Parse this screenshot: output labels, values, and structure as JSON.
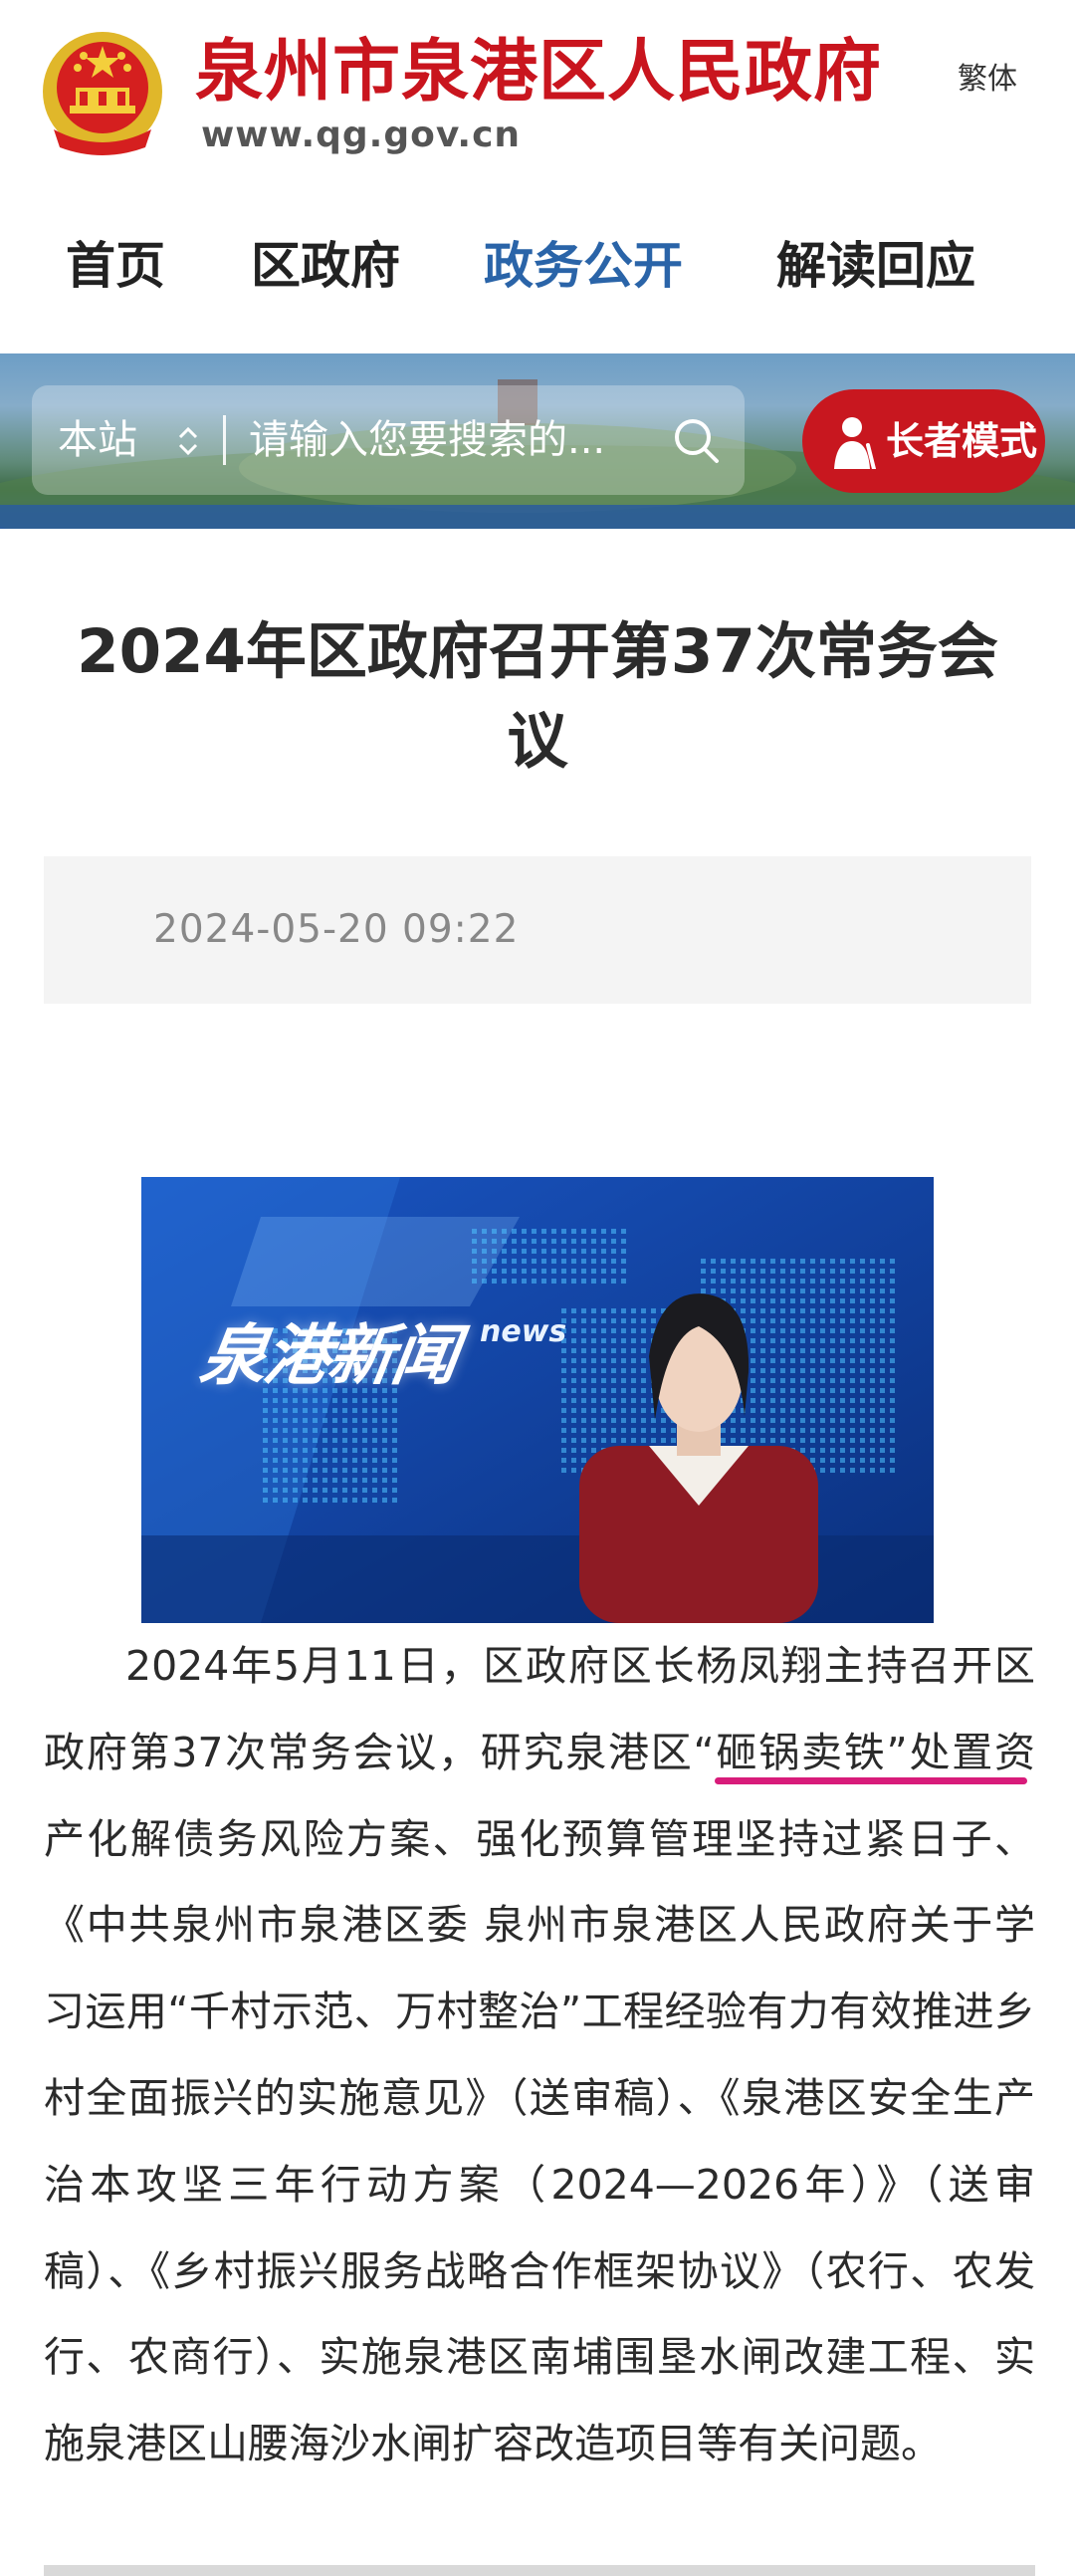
{
  "header": {
    "site_name": "泉州市泉港区人民政府",
    "site_url": "www.qg.gov.cn",
    "traditional_label": "繁体",
    "emblem_icon": "national-emblem-icon"
  },
  "nav": {
    "items": [
      {
        "label": "首页",
        "active": false
      },
      {
        "label": "区政府",
        "active": false
      },
      {
        "label": "政务公开",
        "active": true
      },
      {
        "label": "解读回应",
        "active": false
      }
    ]
  },
  "search": {
    "scope_label": "本站",
    "placeholder": "请输入您要搜索的...",
    "icon": "search-icon"
  },
  "elder_mode": {
    "label": "长者模式",
    "icon": "elder-person-icon"
  },
  "article": {
    "title": "2024年区政府召开第37次常务会议",
    "date": "2024-05-20 09:22",
    "video_logo_text": "泉港新闻",
    "video_logo_en": "news",
    "body": "2024年5月11日，区政府区长杨凤翔主持召开区政府第37次常务会议，研究泉港区“砸锅卖铁”处置资产化解债务风险方案、强化预算管理坚持过紧日子、《中共泉州市泉港区委 泉州市泉港区人民政府关于学习运用“千村示范、万村整治”工程经验有力有效推进乡村全面振兴的实施意见》（送审稿）、《泉港区安全生产治本攻坚三年行动方案（2024—2026年）》（送审稿）、《乡村振兴服务战略合作框架协议》（农行、农发行、农商行）、实施泉港区南埔围垦水闸改建工程、实施泉港区山腰海沙水闸扩容改造项目等有关问题。"
  },
  "colors": {
    "brand_red": "#c9151e",
    "nav_active_blue": "#2a64a8",
    "highlight_pink": "#d81b7a"
  }
}
